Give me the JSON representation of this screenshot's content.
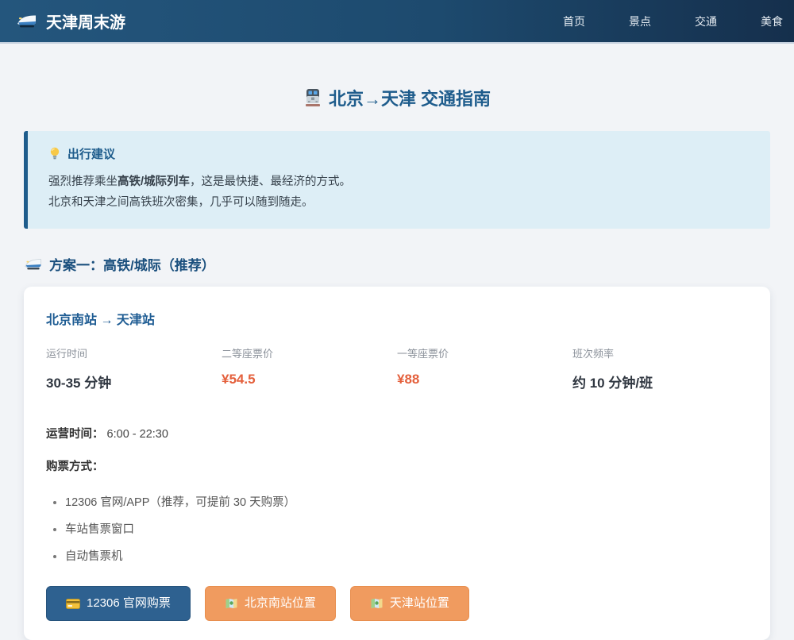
{
  "navbar": {
    "logo": {
      "icon": "bullet-train-icon",
      "title": "天津周末游"
    },
    "items": [
      {
        "label": "首页"
      },
      {
        "label": "景点"
      },
      {
        "label": "交通"
      },
      {
        "label": "美食"
      }
    ]
  },
  "page": {
    "title_icon": "station-train-icon",
    "title": "北京→天津 交通指南"
  },
  "tip": {
    "icon": "lightbulb-icon",
    "title": "出行建议",
    "line1_prefix": "强烈推荐乘坐",
    "line1_bold": "高铁/城际列车",
    "line1_suffix": "，这是最快捷、最经济的方式。",
    "line2": "北京和天津之间高铁班次密集，几乎可以随到随走。"
  },
  "section": {
    "icon": "bullet-train-icon",
    "title": "方案一：高铁/城际（推荐）"
  },
  "card": {
    "route": "北京南站 → 天津站",
    "stats": [
      {
        "label": "运行时间",
        "value": "30-35 分钟"
      },
      {
        "label": "二等座票价",
        "value": "¥54.5"
      },
      {
        "label": "一等座票价",
        "value": "¥88"
      },
      {
        "label": "班次频率",
        "value": "约 10 分钟/班"
      }
    ],
    "operating_label": "运营时间：",
    "operating_value": "6:00 - 22:30",
    "purchase_label": "购票方式：",
    "purchase_methods": [
      "12306 官网/APP（推荐，可提前 30 天购票）",
      "车站售票窗口",
      "自动售票机"
    ],
    "buttons": [
      {
        "icon": "credit-card-icon",
        "label": "12306 官网购票"
      },
      {
        "icon": "map-icon",
        "label": "北京南站位置"
      },
      {
        "icon": "map-icon",
        "label": "天津站位置"
      }
    ]
  },
  "colors": {
    "navbar_gradient_start": "#24567d",
    "navbar_gradient_end": "#152f4c",
    "accent_blue": "#1e5c8c",
    "tip_background": "#ddeef6",
    "price_orange": "#e4603c",
    "button_blue": "#2e6190",
    "button_orange": "#f09b5f",
    "page_background": "#f2f4f7",
    "card_background": "#ffffff"
  }
}
